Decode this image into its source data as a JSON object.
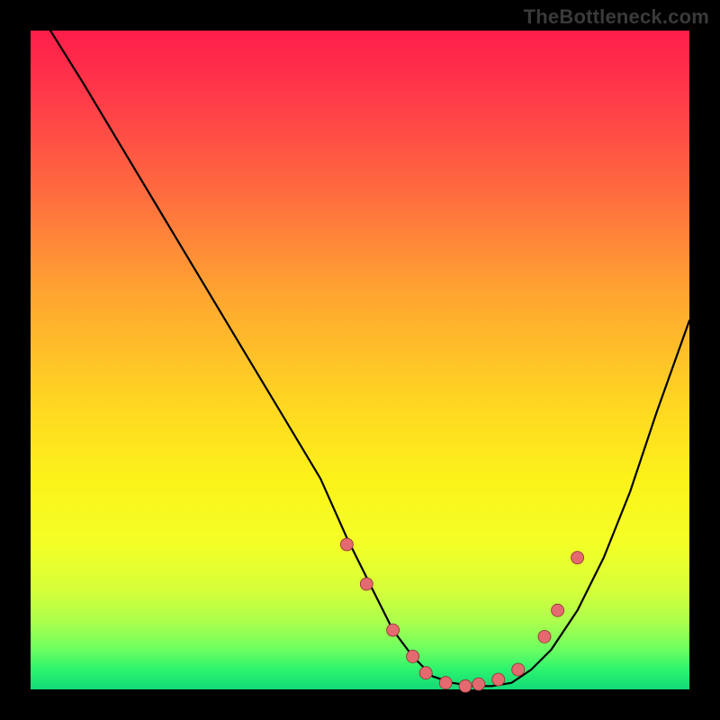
{
  "watermark": "TheBottleneck.com",
  "colors": {
    "background": "#000000",
    "curve": "#000000",
    "marker_fill": "#e46a6f",
    "marker_stroke": "#8e2f34",
    "gradient_stops": [
      "#ff1d4a",
      "#ff3a49",
      "#ff6d3f",
      "#ffa531",
      "#ffd223",
      "#fcf21a",
      "#f3ff26",
      "#d6ff3a",
      "#a8ff4e",
      "#6bff61",
      "#2cf36e",
      "#12d977"
    ]
  },
  "chart_data": {
    "type": "line",
    "title": "",
    "xlabel": "",
    "ylabel": "",
    "xlim": [
      0,
      100
    ],
    "ylim": [
      0,
      100
    ],
    "grid": false,
    "legend": false,
    "annotations": [],
    "series": [
      {
        "name": "bottleneck-curve",
        "x": [
          3,
          8,
          14,
          20,
          26,
          32,
          38,
          44,
          48,
          52,
          55,
          58,
          61,
          64,
          67,
          70,
          73,
          76,
          79,
          83,
          87,
          91,
          95,
          100
        ],
        "y": [
          100,
          92,
          82,
          72,
          62,
          52,
          42,
          32,
          23,
          15,
          9,
          5,
          2,
          1,
          0.5,
          0.5,
          1,
          3,
          6,
          12,
          20,
          30,
          42,
          56
        ]
      }
    ],
    "markers": {
      "name": "highlight-points",
      "x": [
        48,
        51,
        55,
        58,
        60,
        63,
        66,
        68,
        71,
        74,
        78,
        80,
        83
      ],
      "y": [
        22,
        16,
        9,
        5,
        2.5,
        1,
        0.5,
        0.8,
        1.5,
        3,
        8,
        12,
        20
      ]
    }
  }
}
